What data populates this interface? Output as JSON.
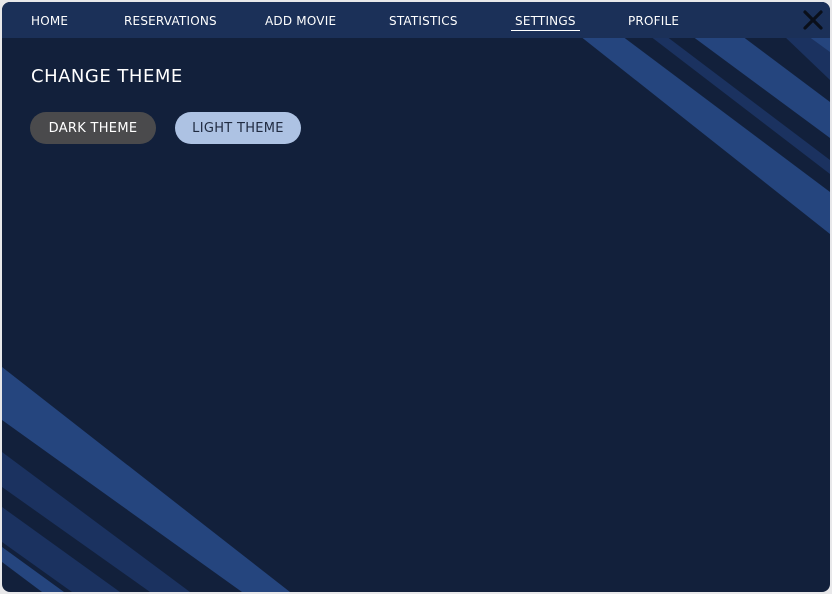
{
  "nav": {
    "items": [
      {
        "label": "HOME"
      },
      {
        "label": "RESERVATIONS"
      },
      {
        "label": "ADD MOVIE"
      },
      {
        "label": "STATISTICS"
      },
      {
        "label": "SETTINGS",
        "active": true
      },
      {
        "label": "PROFILE"
      }
    ],
    "close_icon": "close-x-icon"
  },
  "settings": {
    "title": "CHANGE THEME",
    "dark_theme_label": "DARK THEME",
    "light_theme_label": "LIGHT THEME"
  },
  "colors": {
    "background": "#12203b",
    "navbar": "#1b3058",
    "stripe_light": "#25457e",
    "stripe_dark": "#1b3260",
    "dark_theme_button": "#4a4a4c",
    "light_theme_button": "#adc2e3"
  }
}
